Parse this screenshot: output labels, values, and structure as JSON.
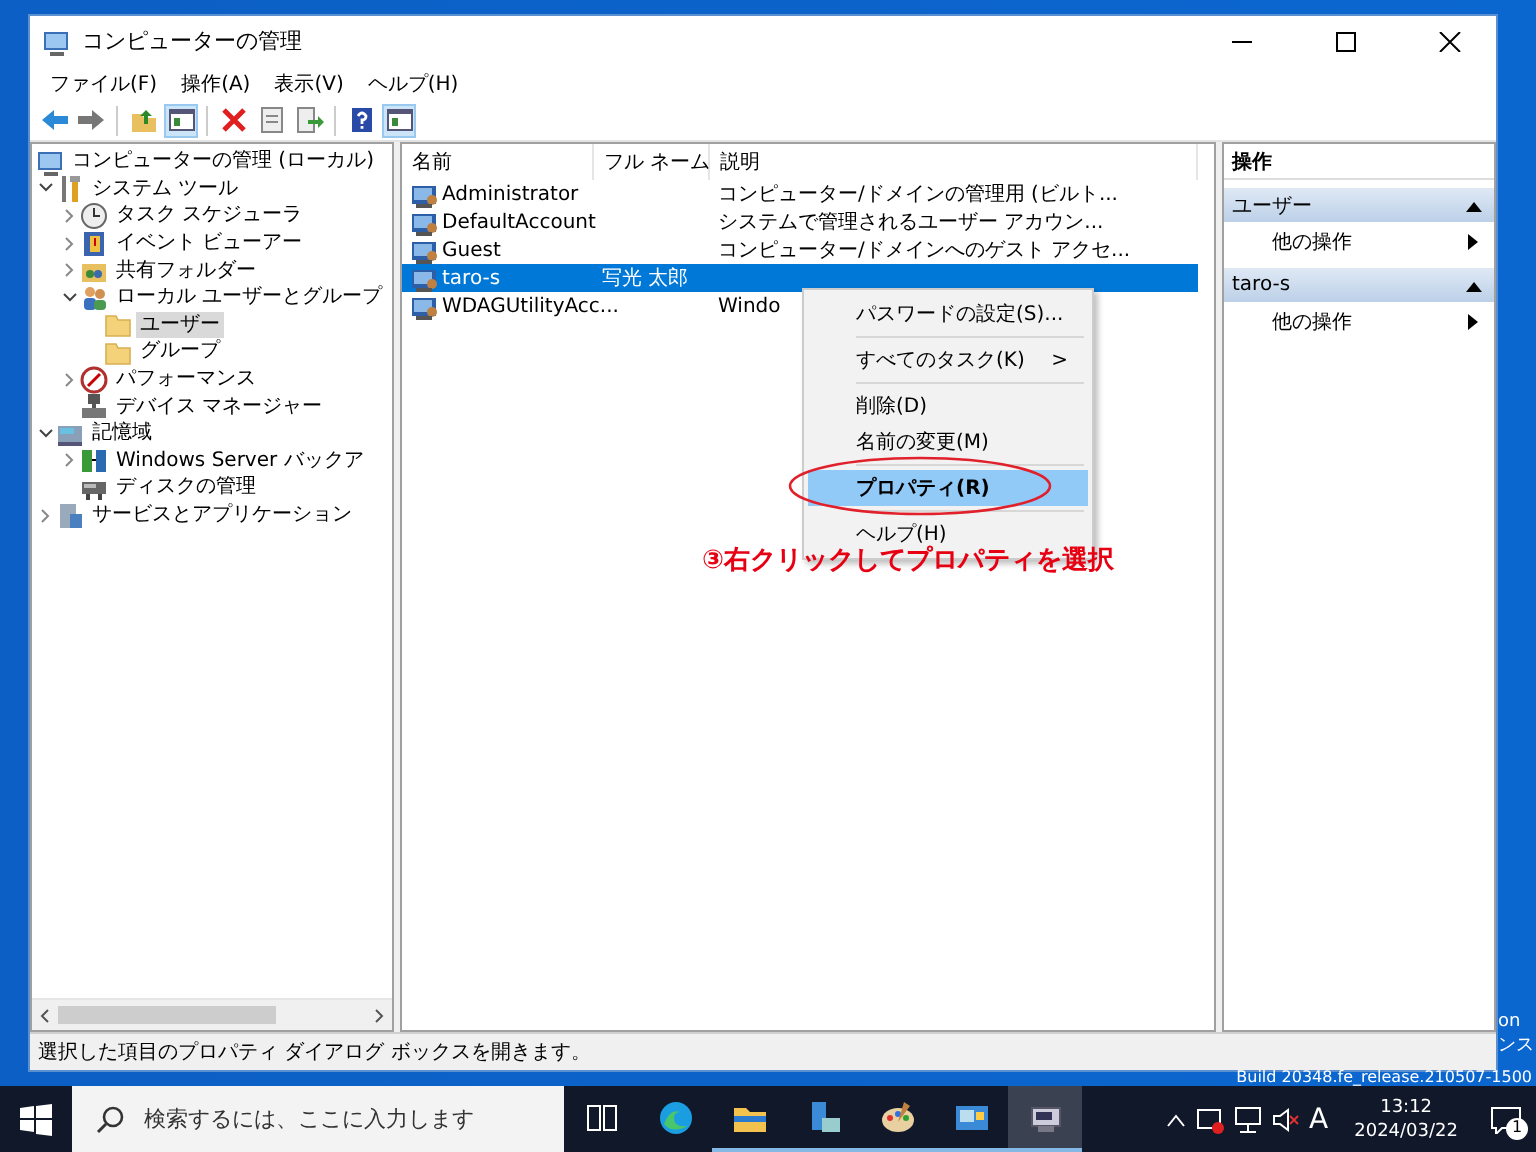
{
  "window": {
    "title": "コンピューターの管理"
  },
  "menu": [
    {
      "label": "ファイル(F)"
    },
    {
      "label": "操作(A)"
    },
    {
      "label": "表示(V)"
    },
    {
      "label": "ヘルプ(H)"
    }
  ],
  "toolbar": [
    {
      "kind": "back",
      "on": false
    },
    {
      "kind": "forward",
      "on": false
    },
    {
      "kind": "sep"
    },
    {
      "kind": "up",
      "on": false
    },
    {
      "kind": "pane",
      "on": true
    },
    {
      "kind": "sep"
    },
    {
      "kind": "delete",
      "on": false
    },
    {
      "kind": "props",
      "on": false
    },
    {
      "kind": "export",
      "on": false
    },
    {
      "kind": "sep"
    },
    {
      "kind": "help",
      "on": false
    },
    {
      "kind": "pane",
      "on": true
    }
  ],
  "tree": [
    {
      "label": "コンピューターの管理 (ローカル)",
      "kind": "computer",
      "selected": false,
      "children": [
        {
          "label": "システム ツール",
          "kind": "tools",
          "expanded": true,
          "selected": false,
          "children": [
            {
              "label": "タスク スケジューラ",
              "kind": "clock",
              "expanded": false,
              "selected": false
            },
            {
              "label": "イベント ビューアー",
              "kind": "log",
              "expanded": false,
              "selected": false
            },
            {
              "label": "共有フォルダー",
              "kind": "share",
              "expanded": false,
              "selected": false
            },
            {
              "label": "ローカル ユーザーとグループ",
              "kind": "users",
              "expanded": true,
              "selected": false,
              "children": [
                {
                  "label": "ユーザー",
                  "kind": "folder",
                  "selected": true
                },
                {
                  "label": "グループ",
                  "kind": "folder",
                  "selected": false
                }
              ]
            },
            {
              "label": "パフォーマンス",
              "kind": "perf",
              "expanded": false,
              "selected": false
            },
            {
              "label": "デバイス マネージャー",
              "kind": "device",
              "selected": false
            }
          ]
        },
        {
          "label": "記憶域",
          "kind": "storage",
          "expanded": true,
          "selected": false,
          "children": [
            {
              "label": "Windows Server バックア",
              "kind": "backup",
              "expanded": false,
              "selected": false
            },
            {
              "label": "ディスクの管理",
              "kind": "disk",
              "selected": false
            }
          ]
        },
        {
          "label": "サービスとアプリケーション",
          "kind": "services",
          "expanded": false,
          "selected": false
        }
      ]
    }
  ],
  "list": {
    "columns": [
      "名前",
      "フル ネーム",
      "説明"
    ],
    "rows": [
      {
        "name": "Administrator",
        "full_name": "",
        "description": "コンピューター/ドメインの管理用 (ビルト...",
        "selected": false
      },
      {
        "name": "DefaultAccount",
        "full_name": "",
        "description": "システムで管理されるユーザー アカウン...",
        "selected": false
      },
      {
        "name": "Guest",
        "full_name": "",
        "description": "コンピューター/ドメインへのゲスト アクセ...",
        "selected": false
      },
      {
        "name": "taro-s",
        "full_name": "写光 太郎",
        "description": "",
        "selected": true
      },
      {
        "name": "WDAGUtilityAcc...",
        "full_name": "",
        "description": "Windo",
        "selected": false
      }
    ]
  },
  "context_menu": [
    {
      "kind": "item",
      "label": "パスワードの設定(S)...",
      "selected": false
    },
    {
      "kind": "sep"
    },
    {
      "kind": "submenu",
      "label": "すべてのタスク(K)",
      "arrow": ">",
      "selected": false
    },
    {
      "kind": "sep"
    },
    {
      "kind": "item",
      "label": "削除(D)",
      "selected": false
    },
    {
      "kind": "item",
      "label": "名前の変更(M)",
      "selected": false
    },
    {
      "kind": "sep"
    },
    {
      "kind": "item",
      "label": "プロパティ(R)",
      "selected": true
    },
    {
      "kind": "sep"
    },
    {
      "kind": "item",
      "label": "ヘルプ(H)",
      "selected": false
    }
  ],
  "annotation": {
    "text": "③右クリックしてプロパティを選択"
  },
  "actions_pane": {
    "title": "操作",
    "sections": [
      {
        "title": "ユーザー",
        "expanded": true,
        "items": [
          "他の操作"
        ]
      },
      {
        "title": "taro-s",
        "expanded": true,
        "items": [
          "他の操作"
        ]
      }
    ]
  },
  "status_bar": {
    "text": "選択した項目のプロパティ ダイアログ ボックスを開きます。"
  },
  "desktop": {
    "texts": [
      "on",
      "ンス"
    ],
    "build": "Build 20348.fe_release.210507-1500"
  },
  "taskbar": {
    "search_placeholder": "検索するには、ここに入力します",
    "apps": [
      {
        "kind": "taskview",
        "running": false,
        "active": false
      },
      {
        "kind": "edge",
        "running": false,
        "active": false
      },
      {
        "kind": "folder",
        "running": true,
        "active": false
      },
      {
        "kind": "server",
        "running": true,
        "active": false
      },
      {
        "kind": "paint",
        "running": true,
        "active": false
      },
      {
        "kind": "panel",
        "running": true,
        "active": false
      },
      {
        "kind": "compmgmt",
        "running": true,
        "active": true
      }
    ],
    "ime": "A",
    "time": "13:12",
    "date": "2024/03/22",
    "notifications": "1"
  }
}
